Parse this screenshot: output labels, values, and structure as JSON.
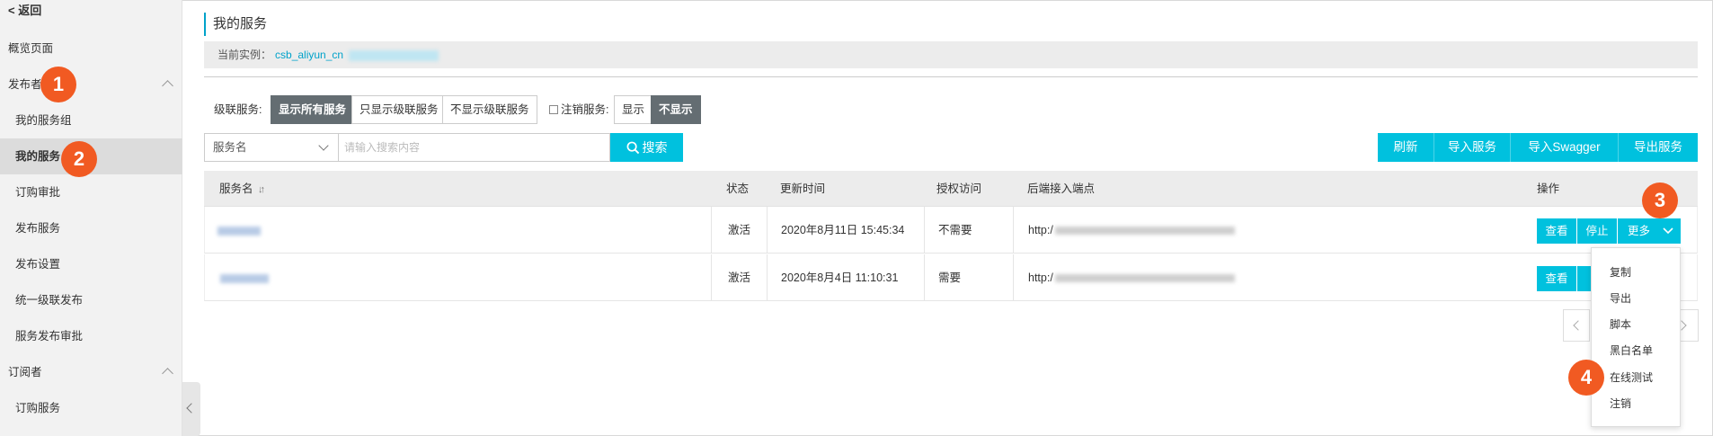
{
  "sidebar": {
    "back_label": "< 返回",
    "overview": "概览页面",
    "publisher_group": "发布者",
    "publisher_items": [
      "我的服务组",
      "我的服务",
      "订购审批",
      "发布服务",
      "发布设置",
      "统一级联发布",
      "服务发布审批"
    ],
    "subscriber_group": "订阅者",
    "subscriber_items": [
      "订购服务"
    ]
  },
  "badges": [
    "1",
    "2",
    "3",
    "4"
  ],
  "header": {
    "title": "我的服务",
    "instance_label": "当前实例：",
    "instance_value": "csb_aliyun_cn"
  },
  "filters": {
    "cascade_label": "级联服务:",
    "cascade_options": [
      "显示所有服务",
      "只显示级联服务",
      "不显示级联服务"
    ],
    "cascade_selected": "显示所有服务",
    "deregistered_label": "注销服务:",
    "deregistered_options": [
      "显示",
      "不显示"
    ],
    "deregistered_selected": "不显示"
  },
  "search": {
    "field_select": "服务名",
    "placeholder": "请输入搜索内容",
    "button": "搜索"
  },
  "toolbar": [
    "刷新",
    "导入服务",
    "导入Swagger",
    "导出服务"
  ],
  "table": {
    "columns": [
      "服务名",
      "状态",
      "更新时间",
      "授权访问",
      "后端接入端点",
      "操作"
    ],
    "sort_icon": "↓↑",
    "rows": [
      {
        "status": "激活",
        "updated": "2020年8月11日 15:45:34",
        "auth": "不需要",
        "endpoint_prefix": "http:/"
      },
      {
        "status": "激活",
        "updated": "2020年8月4日 11:10:31",
        "auth": "需要",
        "endpoint_prefix": "http:/"
      }
    ],
    "actions": {
      "view": "查看",
      "stop": "停止",
      "more": "更多"
    }
  },
  "more_menu": [
    "复制",
    "导出",
    "脚本",
    "黑白名单",
    "在线测试",
    "注销"
  ],
  "colors": {
    "accent": "#00c1de",
    "badge": "#f15a22",
    "selected_segment": "#646d72"
  }
}
